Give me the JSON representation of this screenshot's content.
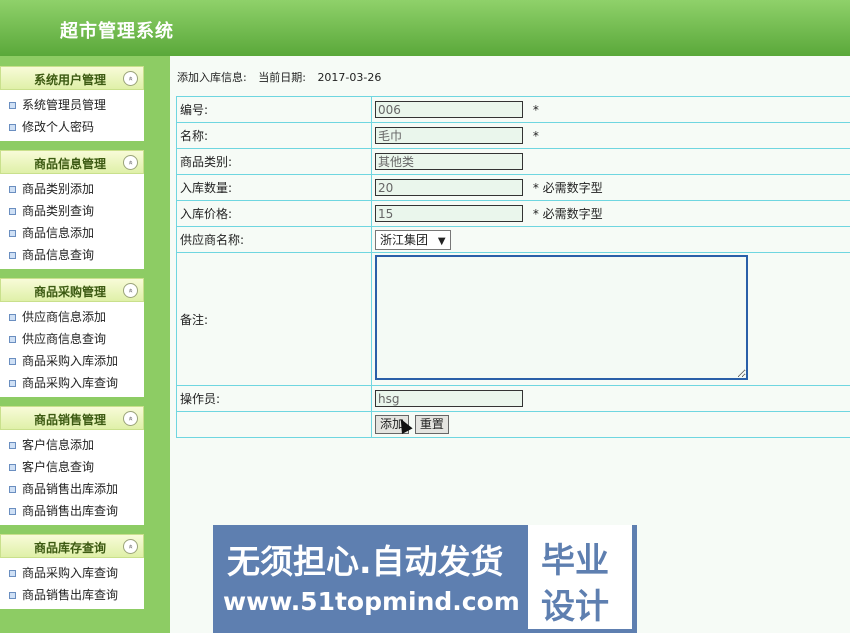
{
  "header": {
    "title": "超市管理系统"
  },
  "sidebar": {
    "sections": [
      {
        "title": "系统用户管理",
        "items": [
          "系统管理员管理",
          "修改个人密码"
        ]
      },
      {
        "title": "商品信息管理",
        "items": [
          "商品类别添加",
          "商品类别查询",
          "商品信息添加",
          "商品信息查询"
        ]
      },
      {
        "title": "商品采购管理",
        "items": [
          "供应商信息添加",
          "供应商信息查询",
          "商品采购入库添加",
          "商品采购入库查询"
        ]
      },
      {
        "title": "商品销售管理",
        "items": [
          "客户信息添加",
          "客户信息查询",
          "商品销售出库添加",
          "商品销售出库查询"
        ]
      },
      {
        "title": "商品库存查询",
        "items": [
          "商品采购入库查询",
          "商品销售出库查询"
        ]
      }
    ],
    "toggle_glyph": "»"
  },
  "main": {
    "heading": "添加入库信息:",
    "date_label": "当前日期:",
    "date_value": "2017-03-26",
    "fields": {
      "code": {
        "label": "编号:",
        "value": "006",
        "suffix": "*"
      },
      "name": {
        "label": "名称:",
        "value": "毛巾",
        "suffix": "*"
      },
      "category": {
        "label": "商品类别:",
        "value": "其他类"
      },
      "quantity": {
        "label": "入库数量:",
        "value": "20",
        "suffix": "* 必需数字型"
      },
      "price": {
        "label": "入库价格:",
        "value": "15",
        "suffix": "* 必需数字型"
      },
      "supplier": {
        "label": "供应商名称:",
        "value": "浙江集团",
        "arrow": "▼"
      },
      "remark": {
        "label": "备注:",
        "value": ""
      },
      "operator": {
        "label": "操作员:",
        "value": "hsg"
      }
    },
    "buttons": {
      "add": "添加",
      "reset": "重置"
    }
  },
  "banner": {
    "line1": "无须担心.自动发货",
    "line2": "www.51topmind.com",
    "box_line1": "毕业",
    "box_line2": "设计"
  }
}
